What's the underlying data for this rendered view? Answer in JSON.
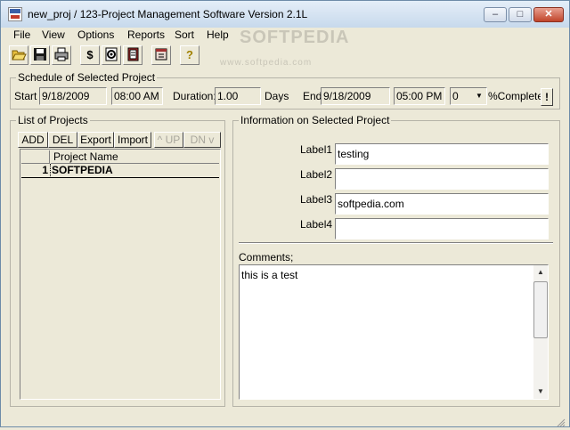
{
  "window": {
    "title": "new_proj  /  123-Project Management Software Version 2.1L",
    "minimize_glyph": "–",
    "maximize_glyph": "□",
    "close_glyph": "✕"
  },
  "menu": [
    "File",
    "View",
    "Options",
    "Reports",
    "Sort",
    "Help"
  ],
  "toolbar": {
    "icons": [
      "open-folder-icon",
      "save-disk-icon",
      "print-icon",
      "dollar-icon",
      "gear-icon",
      "notebook-icon",
      "calendar-icon",
      "help-question-icon"
    ],
    "dollar_glyph": "$",
    "help_glyph": "?"
  },
  "watermark": {
    "big": "SOFTPEDIA",
    "small": "www.softpedia.com"
  },
  "schedule": {
    "legend": "Schedule of Selected Project",
    "start_label": "Start :",
    "start_date": "9/18/2009",
    "start_time": "08:00 AM",
    "duration_label": "Duration:",
    "duration_value": "1.00",
    "days_label": "Days",
    "end_label": "End",
    "end_date": "9/18/2009",
    "end_time": "05:00 PM",
    "percent_value": "0",
    "percent_label": "%Complete",
    "alert_glyph": "!"
  },
  "projects": {
    "legend": "List of Projects",
    "buttons": {
      "add": "ADD",
      "del": "DEL",
      "export": "Export",
      "import": "Import",
      "up": "^ UP",
      "down": "DN v"
    },
    "column_header": "Project Name",
    "rows": [
      {
        "num": "1",
        "name": "SOFTPEDIA"
      }
    ]
  },
  "info": {
    "legend": "Information on Selected Project",
    "label1": "Label1",
    "value1": "testing",
    "label2": "Label2",
    "value2": "",
    "label3": "Label3",
    "value3": "softpedia.com",
    "label4": "Label4",
    "value4": "",
    "comments_label": "Comments;",
    "comments_value": "this is a test"
  }
}
